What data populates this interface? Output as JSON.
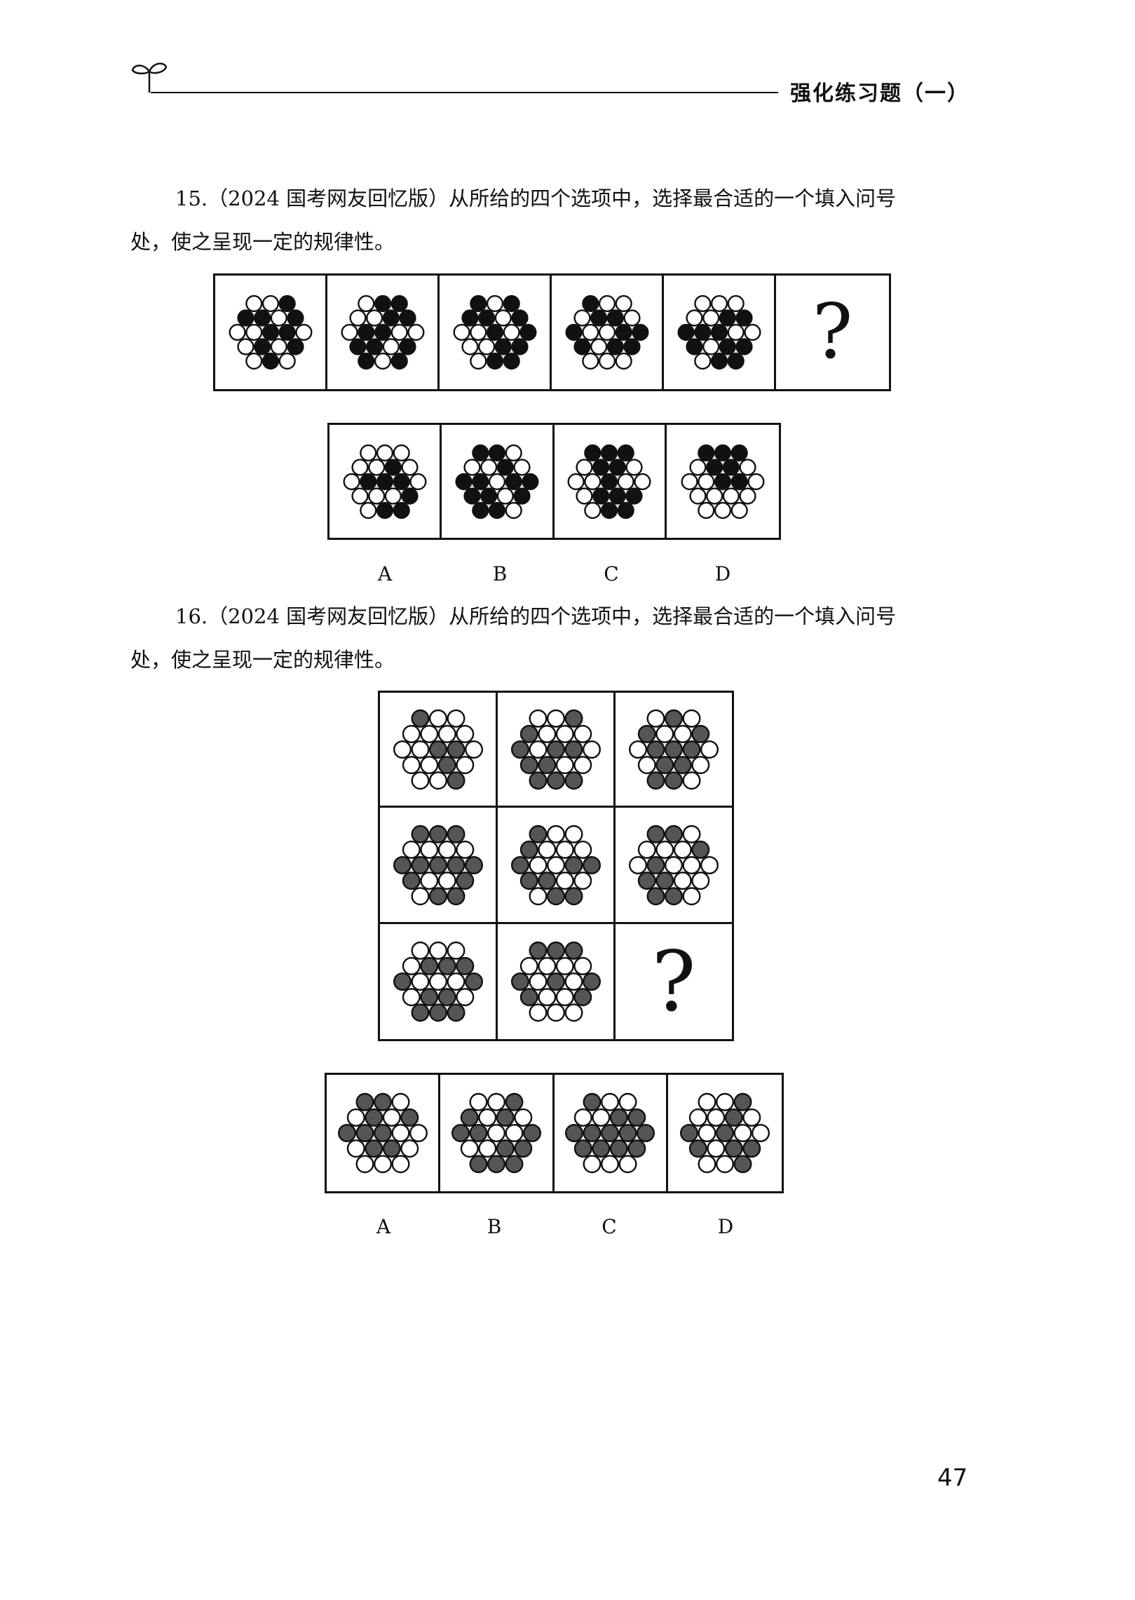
{
  "header": {
    "title": "强化练习题（一）",
    "icon": "sprout-icon"
  },
  "q15": {
    "line1": "15.（2024 国考网友回忆版）从所给的四个选项中，选择最合适的一个填入问号",
    "line2": "处，使之呈现一定的规律性。",
    "question_mark": "?",
    "options": [
      "A",
      "B",
      "C",
      "D"
    ],
    "dark_color": "#111111"
  },
  "q16": {
    "line1": "16.（2024 国考网友回忆版）从所给的四个选项中，选择最合适的一个填入问号",
    "line2": "处，使之呈现一定的规律性。",
    "question_mark": "?",
    "options": [
      "A",
      "B",
      "C",
      "D"
    ],
    "dark_color": "#555555"
  },
  "page_number": "47"
}
